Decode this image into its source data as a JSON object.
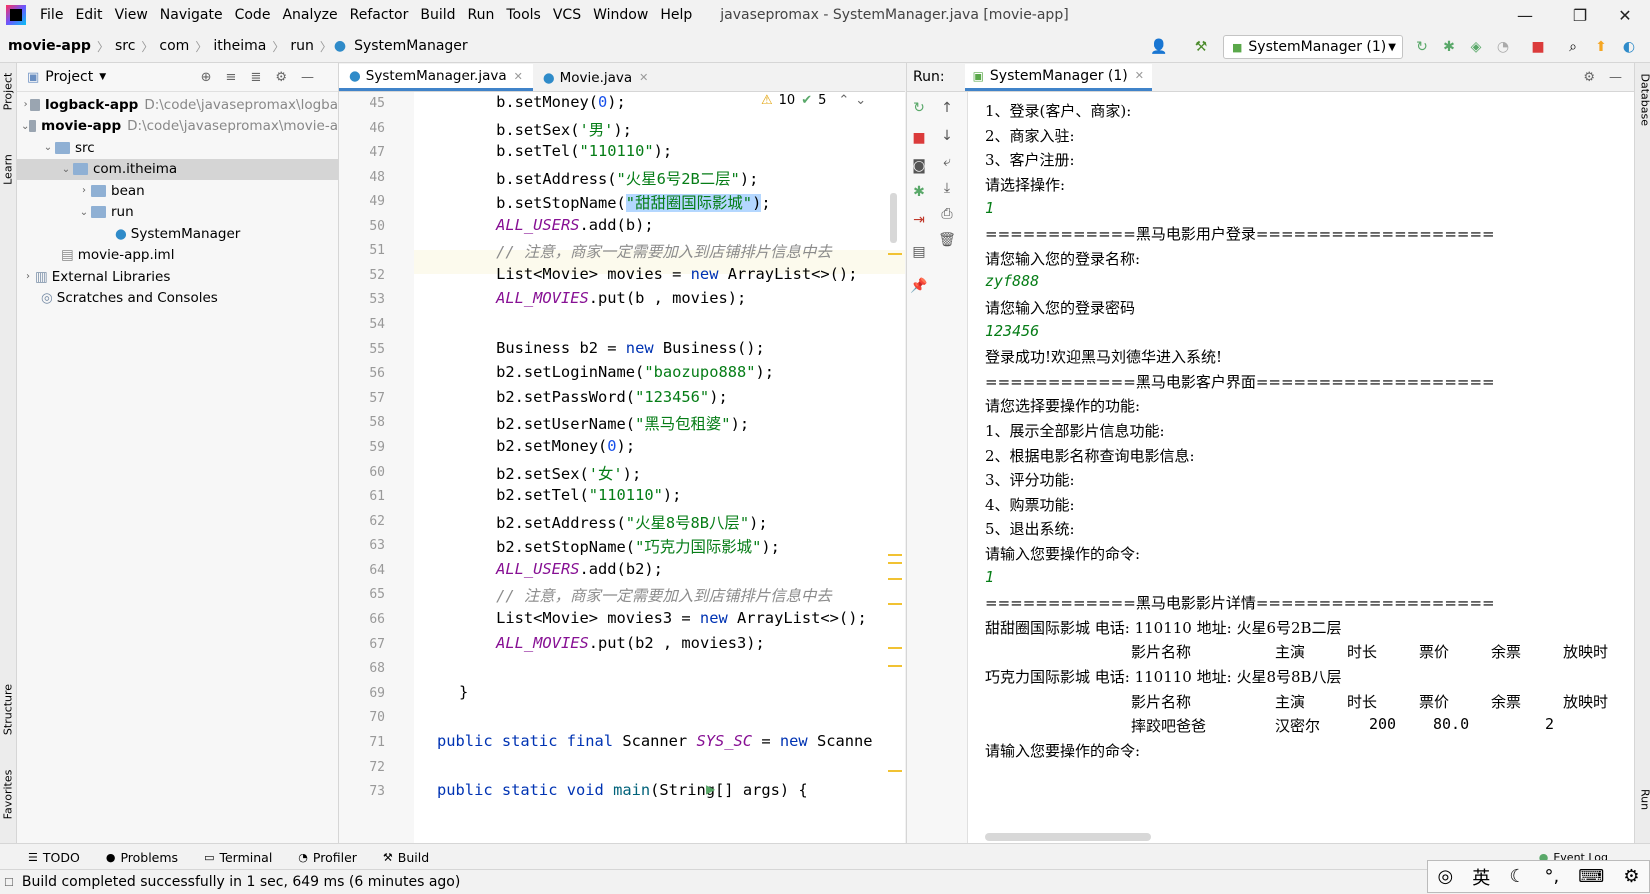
{
  "menubar": {
    "items": [
      "File",
      "Edit",
      "View",
      "Navigate",
      "Code",
      "Analyze",
      "Refactor",
      "Build",
      "Run",
      "Tools",
      "VCS",
      "Window",
      "Help"
    ],
    "window_title": "javasepromax - SystemManager.java [movie-app]"
  },
  "navbar": {
    "crumbs": [
      "movie-app",
      "src",
      "com",
      "itheima",
      "run",
      "SystemManager"
    ],
    "run_config": "SystemManager (1)"
  },
  "project": {
    "title": "Project",
    "tree": [
      {
        "label": "logback-app",
        "path": "D:\\code\\javasepromax\\logba"
      },
      {
        "label": "movie-app",
        "path": "D:\\code\\javasepromax\\movie-a"
      },
      {
        "label": "src"
      },
      {
        "label": "com.itheima"
      },
      {
        "label": "bean"
      },
      {
        "label": "run"
      },
      {
        "label": "SystemManager"
      },
      {
        "label": "movie-app.iml"
      },
      {
        "label": "External Libraries"
      },
      {
        "label": "Scratches and Consoles"
      }
    ]
  },
  "editor": {
    "tabs": [
      "SystemManager.java",
      "Movie.java"
    ],
    "warnings": "10",
    "oks": "5",
    "line_numbers": [
      "45",
      "46",
      "47",
      "48",
      "49",
      "50",
      "51",
      "52",
      "53",
      "54",
      "55",
      "56",
      "57",
      "58",
      "59",
      "60",
      "61",
      "62",
      "63",
      "64",
      "65",
      "66",
      "67",
      "68",
      "69",
      "70",
      "71",
      "72",
      "73"
    ]
  },
  "run": {
    "label": "Run:",
    "tab": "SystemManager (1)",
    "console": [
      "1、登录(客户、商家):",
      "2、商家入驻:",
      "3、客户注册:",
      "请选择操作:",
      "1",
      "============黑马电影用户登录===================",
      "请您输入您的登录名称:",
      "zyf888",
      "请您输入您的登录密码",
      "123456",
      "登录成功!欢迎黑马刘德华进入系统!",
      "============黑马电影客户界面===================",
      "请您选择要操作的功能:",
      "1、展示全部影片信息功能:",
      "2、根据电影名称查询电影信息:",
      "3、评分功能:",
      "4、购票功能:",
      "5、退出系统:",
      "请输入您要操作的命令:",
      "1",
      "============黑马电影影片详情===================",
      "甜甜圈国际影城 电话: 110110 地址: 火星6号2B二层",
      "影片名称",
      "主演",
      "时长",
      "票价",
      "余票",
      "放映时",
      "巧克力国际影城 电话: 110110 地址: 火星8号8B八层",
      "影片名称",
      "主演",
      "时长",
      "票价",
      "余票",
      "放映时",
      "摔跤吧爸爸",
      "汉密尔",
      "200",
      "80.0",
      "2",
      "请输入您要操作的命令:"
    ]
  },
  "left_stripe": [
    "Project",
    "Learn",
    "Structure",
    "Favorites"
  ],
  "right_stripe": [
    "Database",
    "Run"
  ],
  "bottombar": {
    "items": [
      "TODO",
      "Problems",
      "Terminal",
      "Profiler",
      "Build"
    ],
    "event_log": "Event Log"
  },
  "status": "Build completed successfully in 1 sec, 649 ms (6 minutes ago)",
  "ime": {
    "lang": "英"
  }
}
